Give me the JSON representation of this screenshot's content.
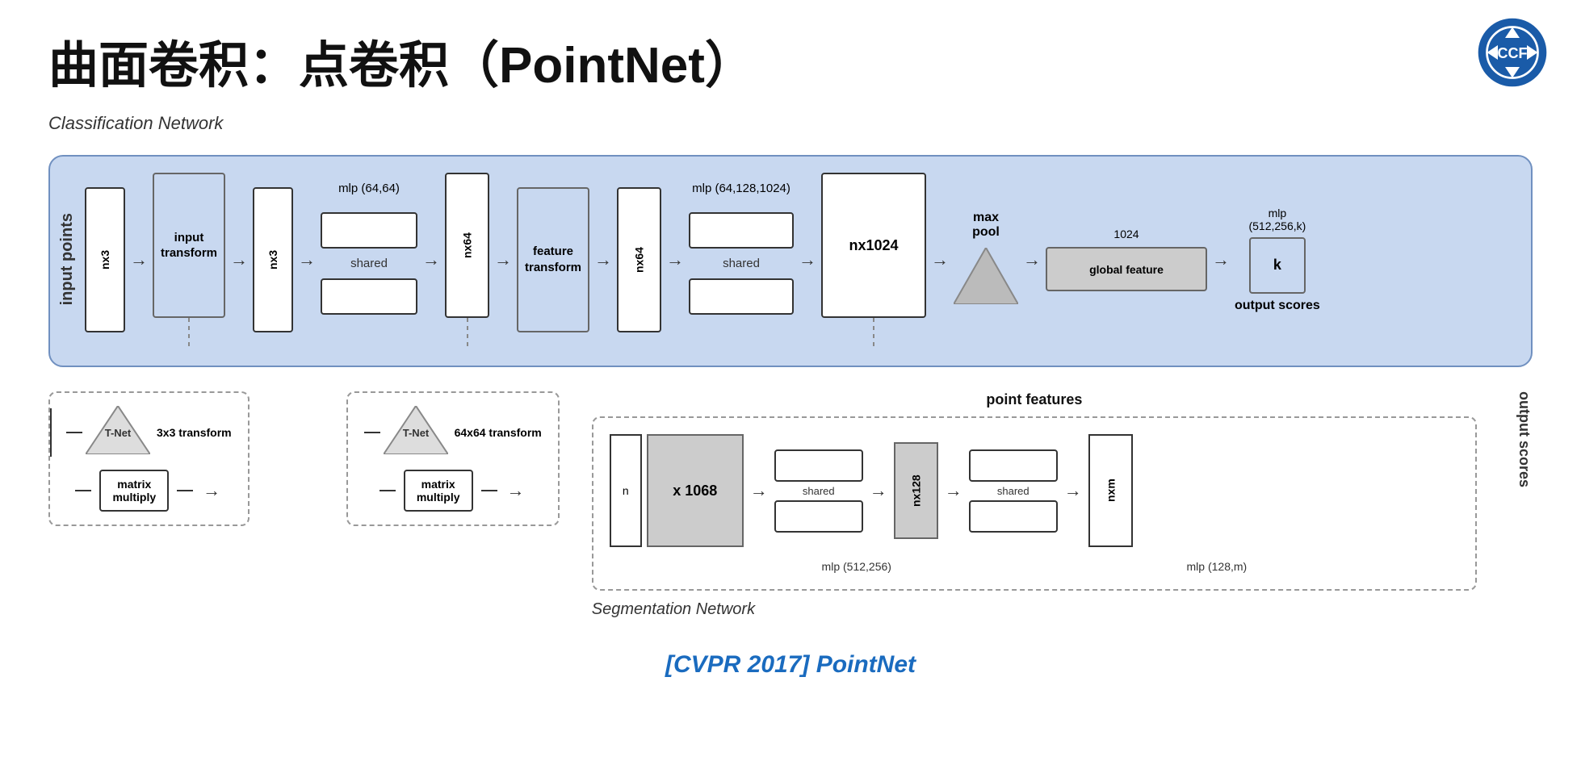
{
  "title": "曲面卷积：点卷积（PointNet）",
  "classification_label": "Classification Network",
  "segmentation_label": "Segmentation Network",
  "citation": "[CVPR 2017] PointNet",
  "input_points_label": "input points",
  "output_scores_label": "output scores",
  "class_network": {
    "nx3_1": "nx3",
    "nx3_2": "nx3",
    "nx64": "nx64",
    "nx64b": "nx64",
    "nx1024": "nx1024",
    "input_transform": "input\ntransform",
    "feature_transform": "feature\ntransform",
    "mlp1_label": "mlp (64,64)",
    "mlp2_label": "mlp (64,128,1024)",
    "shared1": "shared",
    "shared2": "shared",
    "max_pool": "max\npool",
    "global_feature": "global feature",
    "feature_1024": "1024",
    "mlp3_label": "mlp\n(512,256,k)",
    "output_k": "k",
    "output_scores": "output scores"
  },
  "tnet1": {
    "label": "T-Net",
    "transform": "3x3\ntransform",
    "matrix": "matrix\nmultiply"
  },
  "tnet2": {
    "label": "T-Net",
    "transform": "64x64\ntransform",
    "matrix": "matrix\nmultiply"
  },
  "seg_network": {
    "point_features": "point features",
    "n": "n",
    "x1068": "x 1068",
    "shared1": "shared",
    "nx128": "nx128",
    "shared2": "shared",
    "nxm": "nxm",
    "mlp1_label": "mlp (512,256)",
    "mlp2_label": "mlp (128,m)"
  }
}
